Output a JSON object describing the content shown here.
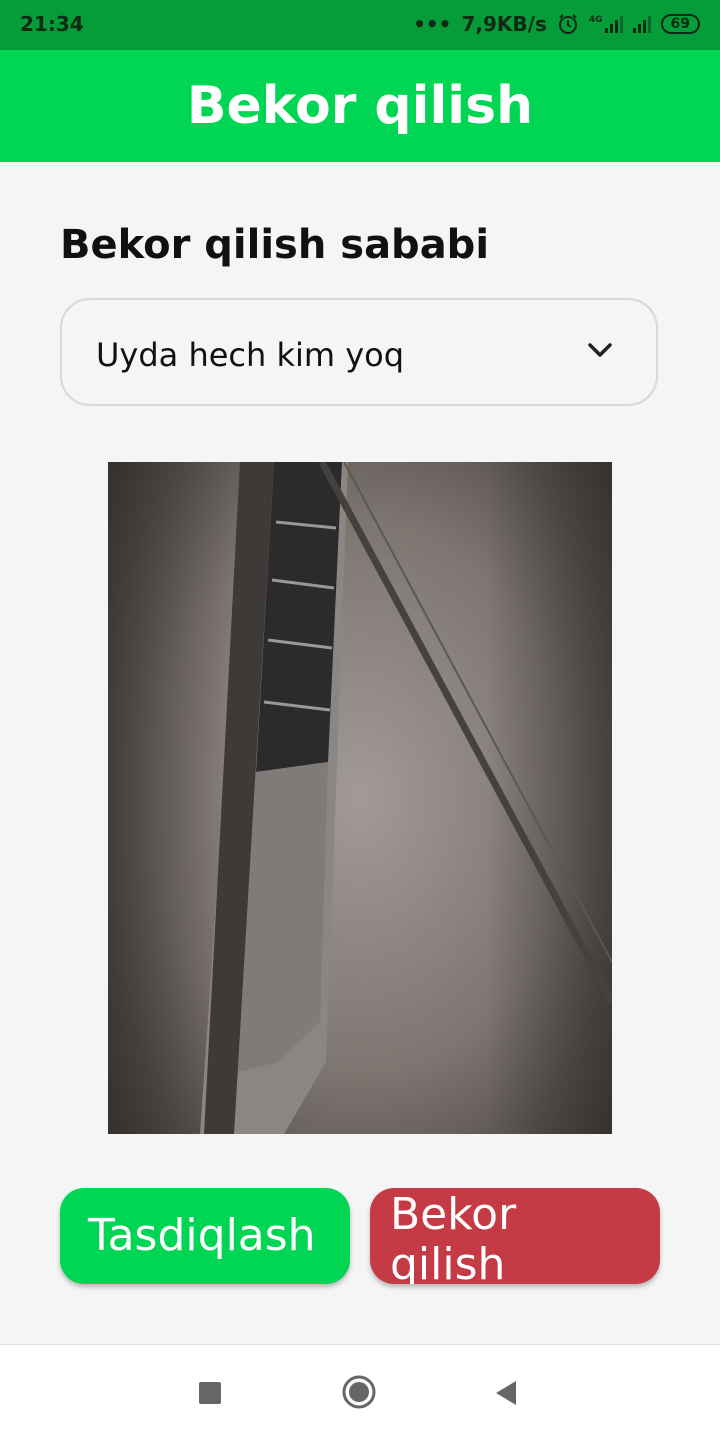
{
  "status_bar": {
    "time": "21:34",
    "net_speed": "7,9KB/s",
    "network_type": "4G",
    "battery": "69",
    "icons": [
      "dots-icon",
      "alarm-icon",
      "signal-4g-icon",
      "signal-icon",
      "battery-icon"
    ]
  },
  "app_bar": {
    "title": "Bekor qilish"
  },
  "form": {
    "reason_label": "Bekor qilish sababi",
    "reason_value": "Uyda hech kim yoq"
  },
  "buttons": {
    "confirm": "Tasdiqlash",
    "cancel": "Bekor qilish"
  },
  "colors": {
    "status_bar": "#079c3a",
    "accent_green": "#00d653",
    "cancel_red": "#c43b46",
    "background": "#f5f5f5"
  },
  "nav_bar": {
    "icons": [
      "recent-apps-icon",
      "home-icon",
      "back-icon"
    ]
  }
}
